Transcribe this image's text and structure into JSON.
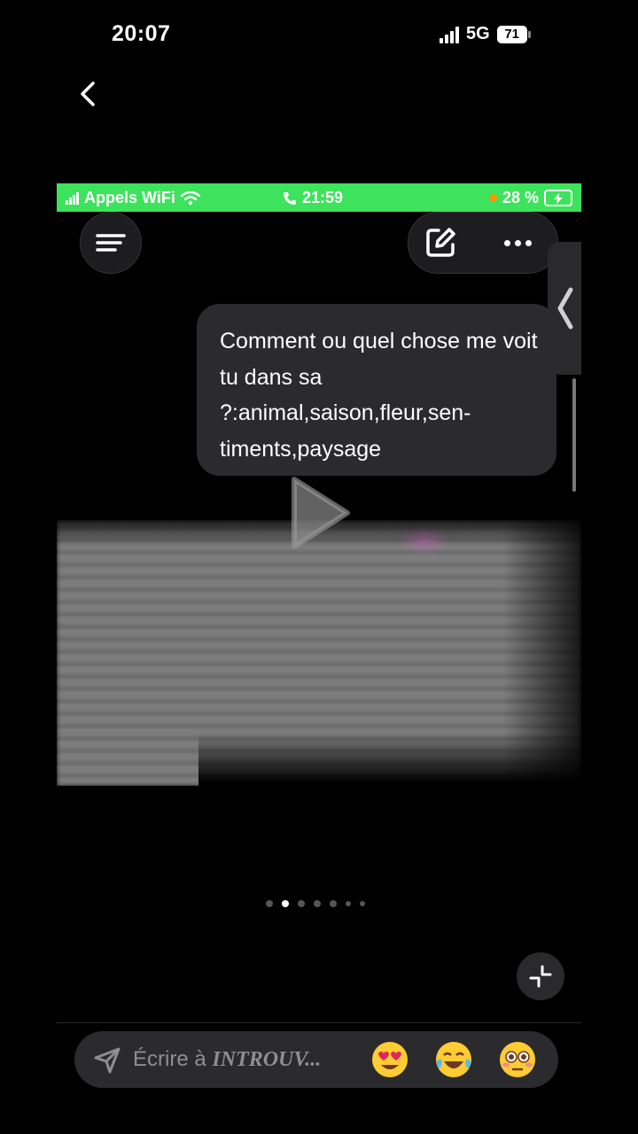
{
  "status_bar": {
    "time": "20:07",
    "network": "5G",
    "battery": "71"
  },
  "screenshot": {
    "status": {
      "carrier": "Appels WiFi",
      "time": "21:59",
      "battery": "28 %"
    },
    "message": "Comment ou quel chose me voit tu dans sa ?:animal,saison,fleur,sen-timents,paysage"
  },
  "pagination": {
    "count": 7,
    "active": 1
  },
  "reply": {
    "prefix": "Écrire à ",
    "recipient": "INTROUV..."
  },
  "reactions": [
    "heart-eyes",
    "tears-of-joy",
    "flushed"
  ],
  "colors": {
    "inner_status_bg": "#3de35c",
    "bubble": "#2b2b2d",
    "background": "#000000"
  }
}
